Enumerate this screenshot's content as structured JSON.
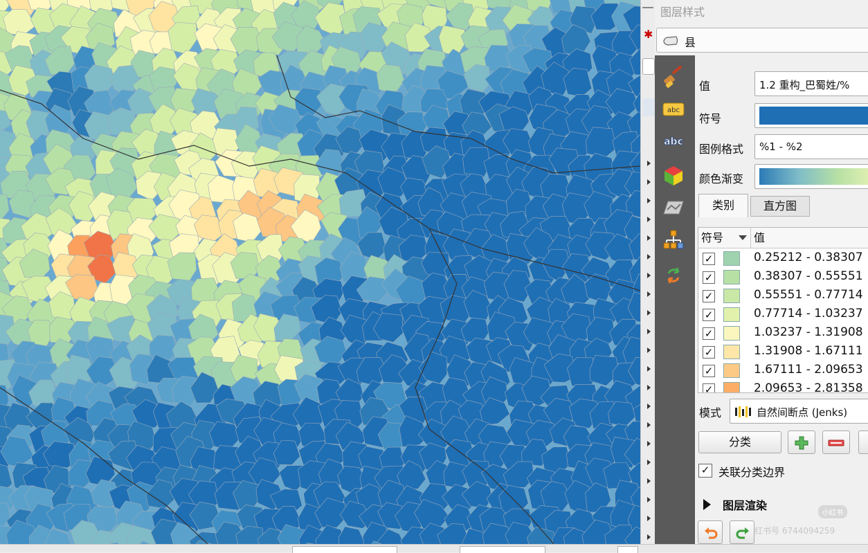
{
  "map": {
    "colors": [
      "#1f6fb5",
      "#2c7bb6",
      "#3f8fc5",
      "#5aa2cc",
      "#7fbcc8",
      "#9fd3b0",
      "#b7e0a5",
      "#d5eea6",
      "#f0f7b6",
      "#fff8c0",
      "#fee4a0",
      "#fdc682",
      "#fba15d",
      "#f07447",
      "#e24530",
      "#d7191c"
    ]
  },
  "panel": {
    "title": "图层样式",
    "layer_name": "县",
    "value_label": "值",
    "value_field": "1.2 重构_巴蜀姓/%",
    "symbol_label": "符号",
    "symbol_color": "#1f6fb5",
    "legend_format_label": "图例格式",
    "legend_format_value": "%1 - %2",
    "ramp_label": "颜色渐变",
    "tabs": [
      "类别",
      "直方图"
    ],
    "table": {
      "col_symbol": "符号",
      "col_value": "值",
      "rows": [
        {
          "range": "0.25212 - 0.38307",
          "color": "#9fd3b0",
          "checked": "✓"
        },
        {
          "range": "0.38307 - 0.55551",
          "color": "#b7e0a5",
          "checked": "✓"
        },
        {
          "range": "0.55551 - 0.77714",
          "color": "#c9e8a6",
          "checked": "✓"
        },
        {
          "range": "0.77714 - 1.03237",
          "color": "#e2f2ad",
          "checked": "✓"
        },
        {
          "range": "1.03237 - 1.31908",
          "color": "#fbf6bd",
          "checked": "✓"
        },
        {
          "range": "1.31908 - 1.67111",
          "color": "#fee6a8",
          "checked": "✓"
        },
        {
          "range": "1.67111 - 2.09653",
          "color": "#fdca86",
          "checked": "✓"
        },
        {
          "range": "2.09653 - 2.81358",
          "color": "#fcae66",
          "checked": "✓"
        }
      ]
    },
    "mode_label": "模式",
    "mode_value": "自然间断点 (Jenks)",
    "classify_button": "分类",
    "link_label": "关联分类边界",
    "link_checked": "✓",
    "render_label": "图层渲染"
  },
  "watermark": "小红书",
  "watermark_id": "红书号 6744094259"
}
